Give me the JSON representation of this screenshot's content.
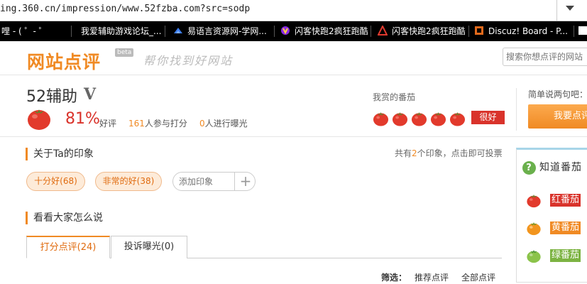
{
  "browser": {
    "address": "ing.360.cn/impression/www.52fzba.com?src=sodp",
    "bookmarks": [
      {
        "label": "哩 - ( ゜- ゜"
      },
      {
        "label": "我爱辅助游戏论坛_..."
      },
      {
        "label": "易语言资源网-学网..."
      },
      {
        "label": "闪客快跑2疯狂跑酷"
      },
      {
        "label": "闪客快跑2疯狂跑酷"
      },
      {
        "label": "Discuz! Board - P..."
      }
    ]
  },
  "site": {
    "logo": "网站点评",
    "beta": "beta",
    "slogan": "帮你找到好网站",
    "search_placeholder": "搜索你想点评的网站"
  },
  "target": {
    "name": "52辅助",
    "v_mark": "V",
    "good_percent": "81%",
    "good_label": "好评",
    "raters_count": "161",
    "raters_label": "人参与打分",
    "exposure_count": "0",
    "exposure_label": "人进行曝光"
  },
  "vote": {
    "label": "我赏的番茄",
    "rating": 5,
    "good_button": "很好"
  },
  "say": {
    "label": "简单说两句吧：",
    "button": "我要点评"
  },
  "impressions": {
    "title": "关于Ta的印象",
    "info_prefix": "共有",
    "count": "2",
    "info_suffix": "个印象，点击即可投票",
    "tags": [
      {
        "label": "十分好(68)"
      },
      {
        "label": "非常的好(38)"
      }
    ],
    "add_placeholder": "添加印象",
    "add_symbol": "+"
  },
  "reviews": {
    "title": "看看大家怎么说",
    "tabs": [
      {
        "label": "打分点评(24)"
      },
      {
        "label": "投诉曝光(0)"
      }
    ],
    "filter_label": "筛选：",
    "filters": [
      {
        "label": "推荐点评"
      },
      {
        "label": "全部点评"
      }
    ]
  },
  "sidebar": {
    "title": "知道番茄",
    "q_mark": "?",
    "items": [
      {
        "label": "红番茄",
        "dash": "-"
      },
      {
        "label": "黄番茄",
        "dash": "-"
      },
      {
        "label": "绿番茄",
        "dash": "-"
      }
    ]
  },
  "colors": {
    "accent": "#f08a24",
    "red": "#d9332b",
    "yellow": "#f08a24",
    "green": "#7cb342"
  }
}
